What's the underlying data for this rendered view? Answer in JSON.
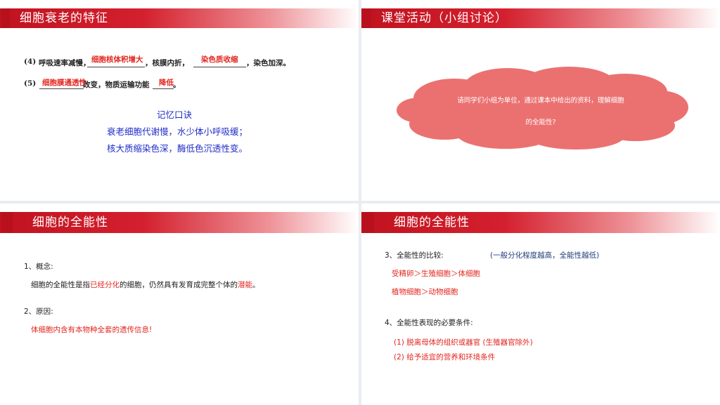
{
  "slide1": {
    "title": "细胞衰老的特征",
    "item4_num": "(4)",
    "item4_a": "呼吸速率减慢，",
    "item4_ans1": "细胞核体积增大",
    "item4_b": "，核膜内折，",
    "item4_ans2": "染色质收缩",
    "item4_c": "，染色加深。",
    "item5_num": "(5)",
    "item5_ans1": "细胞膜通透性",
    "item5_a": "改变，物质运输功能",
    "item5_ans2": "降低",
    "item5_b": "。",
    "mnemonic_title": "记忆口诀",
    "mnemonic_line1": "衰老细胞代谢慢，水少体小呼吸缓；",
    "mnemonic_line2": "核大质缩染色深，酶低色沉透性变。"
  },
  "slide2": {
    "title": "课堂活动（小组讨论）",
    "cloud_line1": "请同学们小组为单位，通过课本中给出的资料，理解细胞",
    "cloud_line2": "的全能性?",
    "cloud_color": "#eb7171"
  },
  "slide3": {
    "title": "细胞的全能性",
    "concept_label": "1、概念:",
    "concept_a": "细胞的全能性是指",
    "concept_red1": "已经分化",
    "concept_b": "的细胞，仍然具有发育成完整个体的",
    "concept_red2": "潜能",
    "concept_c": "。",
    "reason_label": "2、原因:",
    "reason_text": "体细胞内含有本物种全套的遗传信息!"
  },
  "slide4": {
    "title": "细胞的全能性",
    "compare_label": "3、全能性的比较:",
    "compare_note": "(一般分化程度越高，全能性越低)",
    "compare_line1": "受精卵＞生殖细胞＞体细胞",
    "compare_line2": "植物细胞＞动物细胞",
    "cond_label": "4、全能性表现的必要条件:",
    "cond_1": "(1) 脱离母体的组织或器官 (生殖器官除外)",
    "cond_2": "(2) 给予适宜的营养和环境条件"
  },
  "colors": {
    "accent_red": "#c1121f",
    "answer_red": "#e3261f",
    "mnemonic_blue": "#1e2cc8",
    "note_navy": "#22407a"
  }
}
